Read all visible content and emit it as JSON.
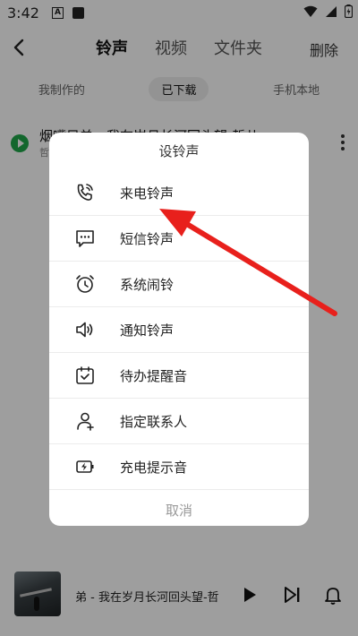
{
  "status_bar": {
    "time": "3:42",
    "notif_a": "A"
  },
  "header": {
    "tabs": [
      {
        "label": "铃声",
        "active": true
      },
      {
        "label": "视频",
        "active": false
      },
      {
        "label": "文件夹",
        "active": false
      }
    ],
    "delete_label": "删除"
  },
  "subtabs": [
    {
      "label": "我制作的",
      "active": false
    },
    {
      "label": "已下载",
      "active": true
    },
    {
      "label": "手机本地",
      "active": false
    }
  ],
  "song": {
    "title": "烟嘴目弟 - 我在岁月长河回头望-哲儿",
    "subtitle": "哲"
  },
  "dialog": {
    "title": "设铃声",
    "options": [
      {
        "label": "来电铃声",
        "icon": "phone-ring-icon"
      },
      {
        "label": "短信铃声",
        "icon": "message-icon"
      },
      {
        "label": "系统闹铃",
        "icon": "alarm-clock-icon"
      },
      {
        "label": "通知铃声",
        "icon": "speaker-icon"
      },
      {
        "label": "待办提醒音",
        "icon": "calendar-check-icon"
      },
      {
        "label": "指定联系人",
        "icon": "add-contact-icon"
      },
      {
        "label": "充电提示音",
        "icon": "battery-charging-icon"
      }
    ],
    "cancel_label": "取消"
  },
  "player": {
    "now_playing": "弟 - 我在岁月长河回头望-哲"
  },
  "colors": {
    "accent_green": "#1fa64a",
    "annotation_red": "#e8201c"
  }
}
